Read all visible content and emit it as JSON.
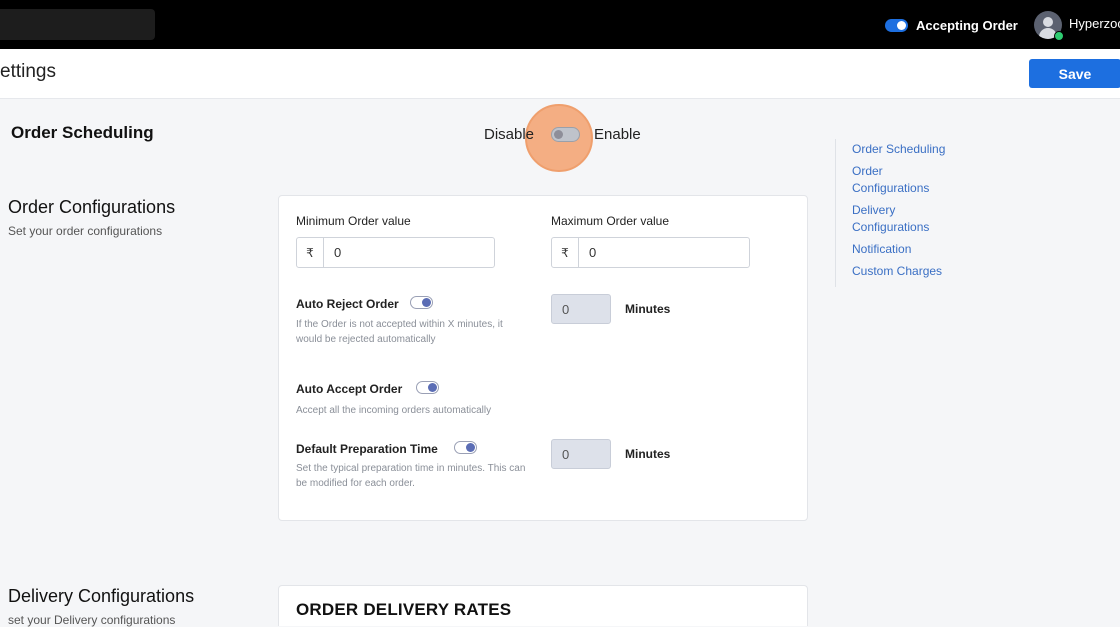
{
  "topbar": {
    "accepting_label": "Accepting Order",
    "user_name": "Hyperzoo"
  },
  "header": {
    "title": "ettings",
    "save_label": "Save"
  },
  "scheduling": {
    "title": "Order Scheduling",
    "disable_label": "Disable",
    "enable_label": "Enable"
  },
  "order_config": {
    "title": "Order Configurations",
    "subtitle": "Set your order configurations",
    "min_label": "Minimum Order value",
    "max_label": "Maximum Order value",
    "currency": "₹",
    "min_value": "0",
    "max_value": "0",
    "auto_reject": {
      "label": "Auto Reject Order",
      "desc": "If the Order is not accepted within X minutes, it would be rejected automatically",
      "minutes": "0",
      "unit": "Minutes"
    },
    "auto_accept": {
      "label": "Auto Accept Order",
      "desc": "Accept all the incoming orders automatically"
    },
    "prep_time": {
      "label": "Default Preparation Time",
      "desc": "Set the typical preparation time in minutes. This can be modified for each order.",
      "minutes": "0",
      "unit": "Minutes"
    }
  },
  "delivery_config": {
    "title": "Delivery Configurations",
    "subtitle": "set your Delivery configurations",
    "card_title": "ORDER DELIVERY RATES"
  },
  "toc": {
    "items": [
      "Order Scheduling",
      "Order Configurations",
      "Delivery Configurations",
      "Notification",
      "Custom Charges"
    ]
  },
  "colors": {
    "accent": "#1d6fe0",
    "link": "#3a6fc4",
    "highlight": "#f4a472"
  }
}
